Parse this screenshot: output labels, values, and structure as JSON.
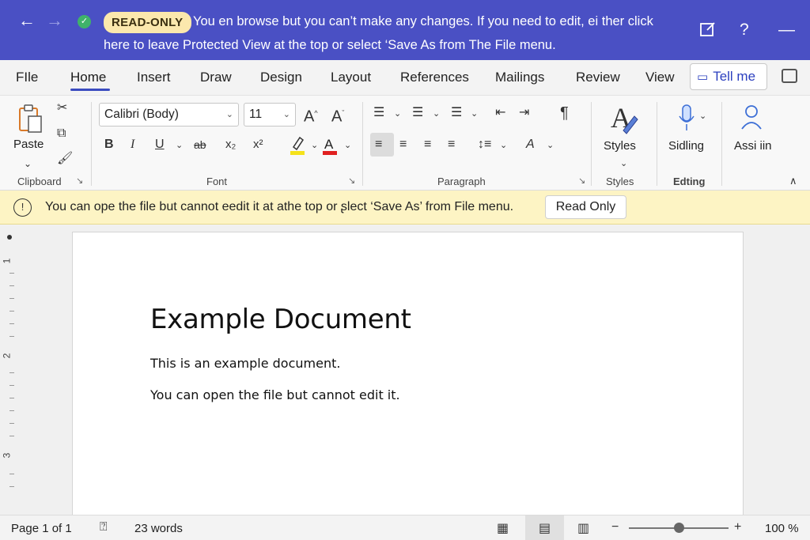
{
  "banner": {
    "badge": "READ-ONLY",
    "line1": "You en browse but you can’t make any changes. If you need to edit, ei ther click",
    "line2": "here to leave Protected View at the top or select ‘Save As from The File menu.",
    "back_icon": "←",
    "forward_icon": "→",
    "check_icon": "✓",
    "edit_icon": "☐",
    "help_icon": "?",
    "minimize_icon": "—"
  },
  "tabs": [
    "FIle",
    "Home",
    "Insert",
    "Draw",
    "Design",
    "Layout",
    "References",
    "Mailings",
    "Review",
    "View"
  ],
  "tell_me": "Tell me",
  "tell_me_icon": "☐",
  "ribbon": {
    "clipboard": {
      "paste": "Paste",
      "label": "Clipboard",
      "paste_arrow": "⌄"
    },
    "font": {
      "label": "Font",
      "name": "Calibri (Body)",
      "size": "11",
      "grow": "A^",
      "shrink": "Aˇ",
      "bold": "B",
      "italic": "I",
      "underline": "U",
      "strike": "ab",
      "subscript": "x₂",
      "superscript": "x²"
    },
    "paragraph": {
      "label": "Paragraph",
      "pilcrow": "¶"
    },
    "styles": {
      "button": "Styles",
      "label": "Styles"
    },
    "editing": {
      "button": "Sidling",
      "label": "Edting"
    },
    "assistant": {
      "button": "Assi iin"
    }
  },
  "infobar": {
    "icon": "!",
    "text": "You can ope the file but cannot eedit it at athe top or ʂlect ‘Save As’ from File menu.",
    "button": "Read Only"
  },
  "ruler": [
    "1",
    "2",
    "3"
  ],
  "document": {
    "title": "Example Document",
    "p1": "This is an example document.",
    "p2": "You can open the file but cannot edit it."
  },
  "status": {
    "page": "Page 1 of 1",
    "words": "23 words",
    "zoom": "100 %",
    "zoom_level": 1.0,
    "zoom_minus": "−",
    "zoom_plus": "+"
  },
  "colors": {
    "banner": "#4a50c4",
    "badge": "#fbe8ad",
    "infobar": "#fdf4c4",
    "accent": "#3b4cc0",
    "highlight": "#f5e21a",
    "font_color": "#e02020"
  }
}
